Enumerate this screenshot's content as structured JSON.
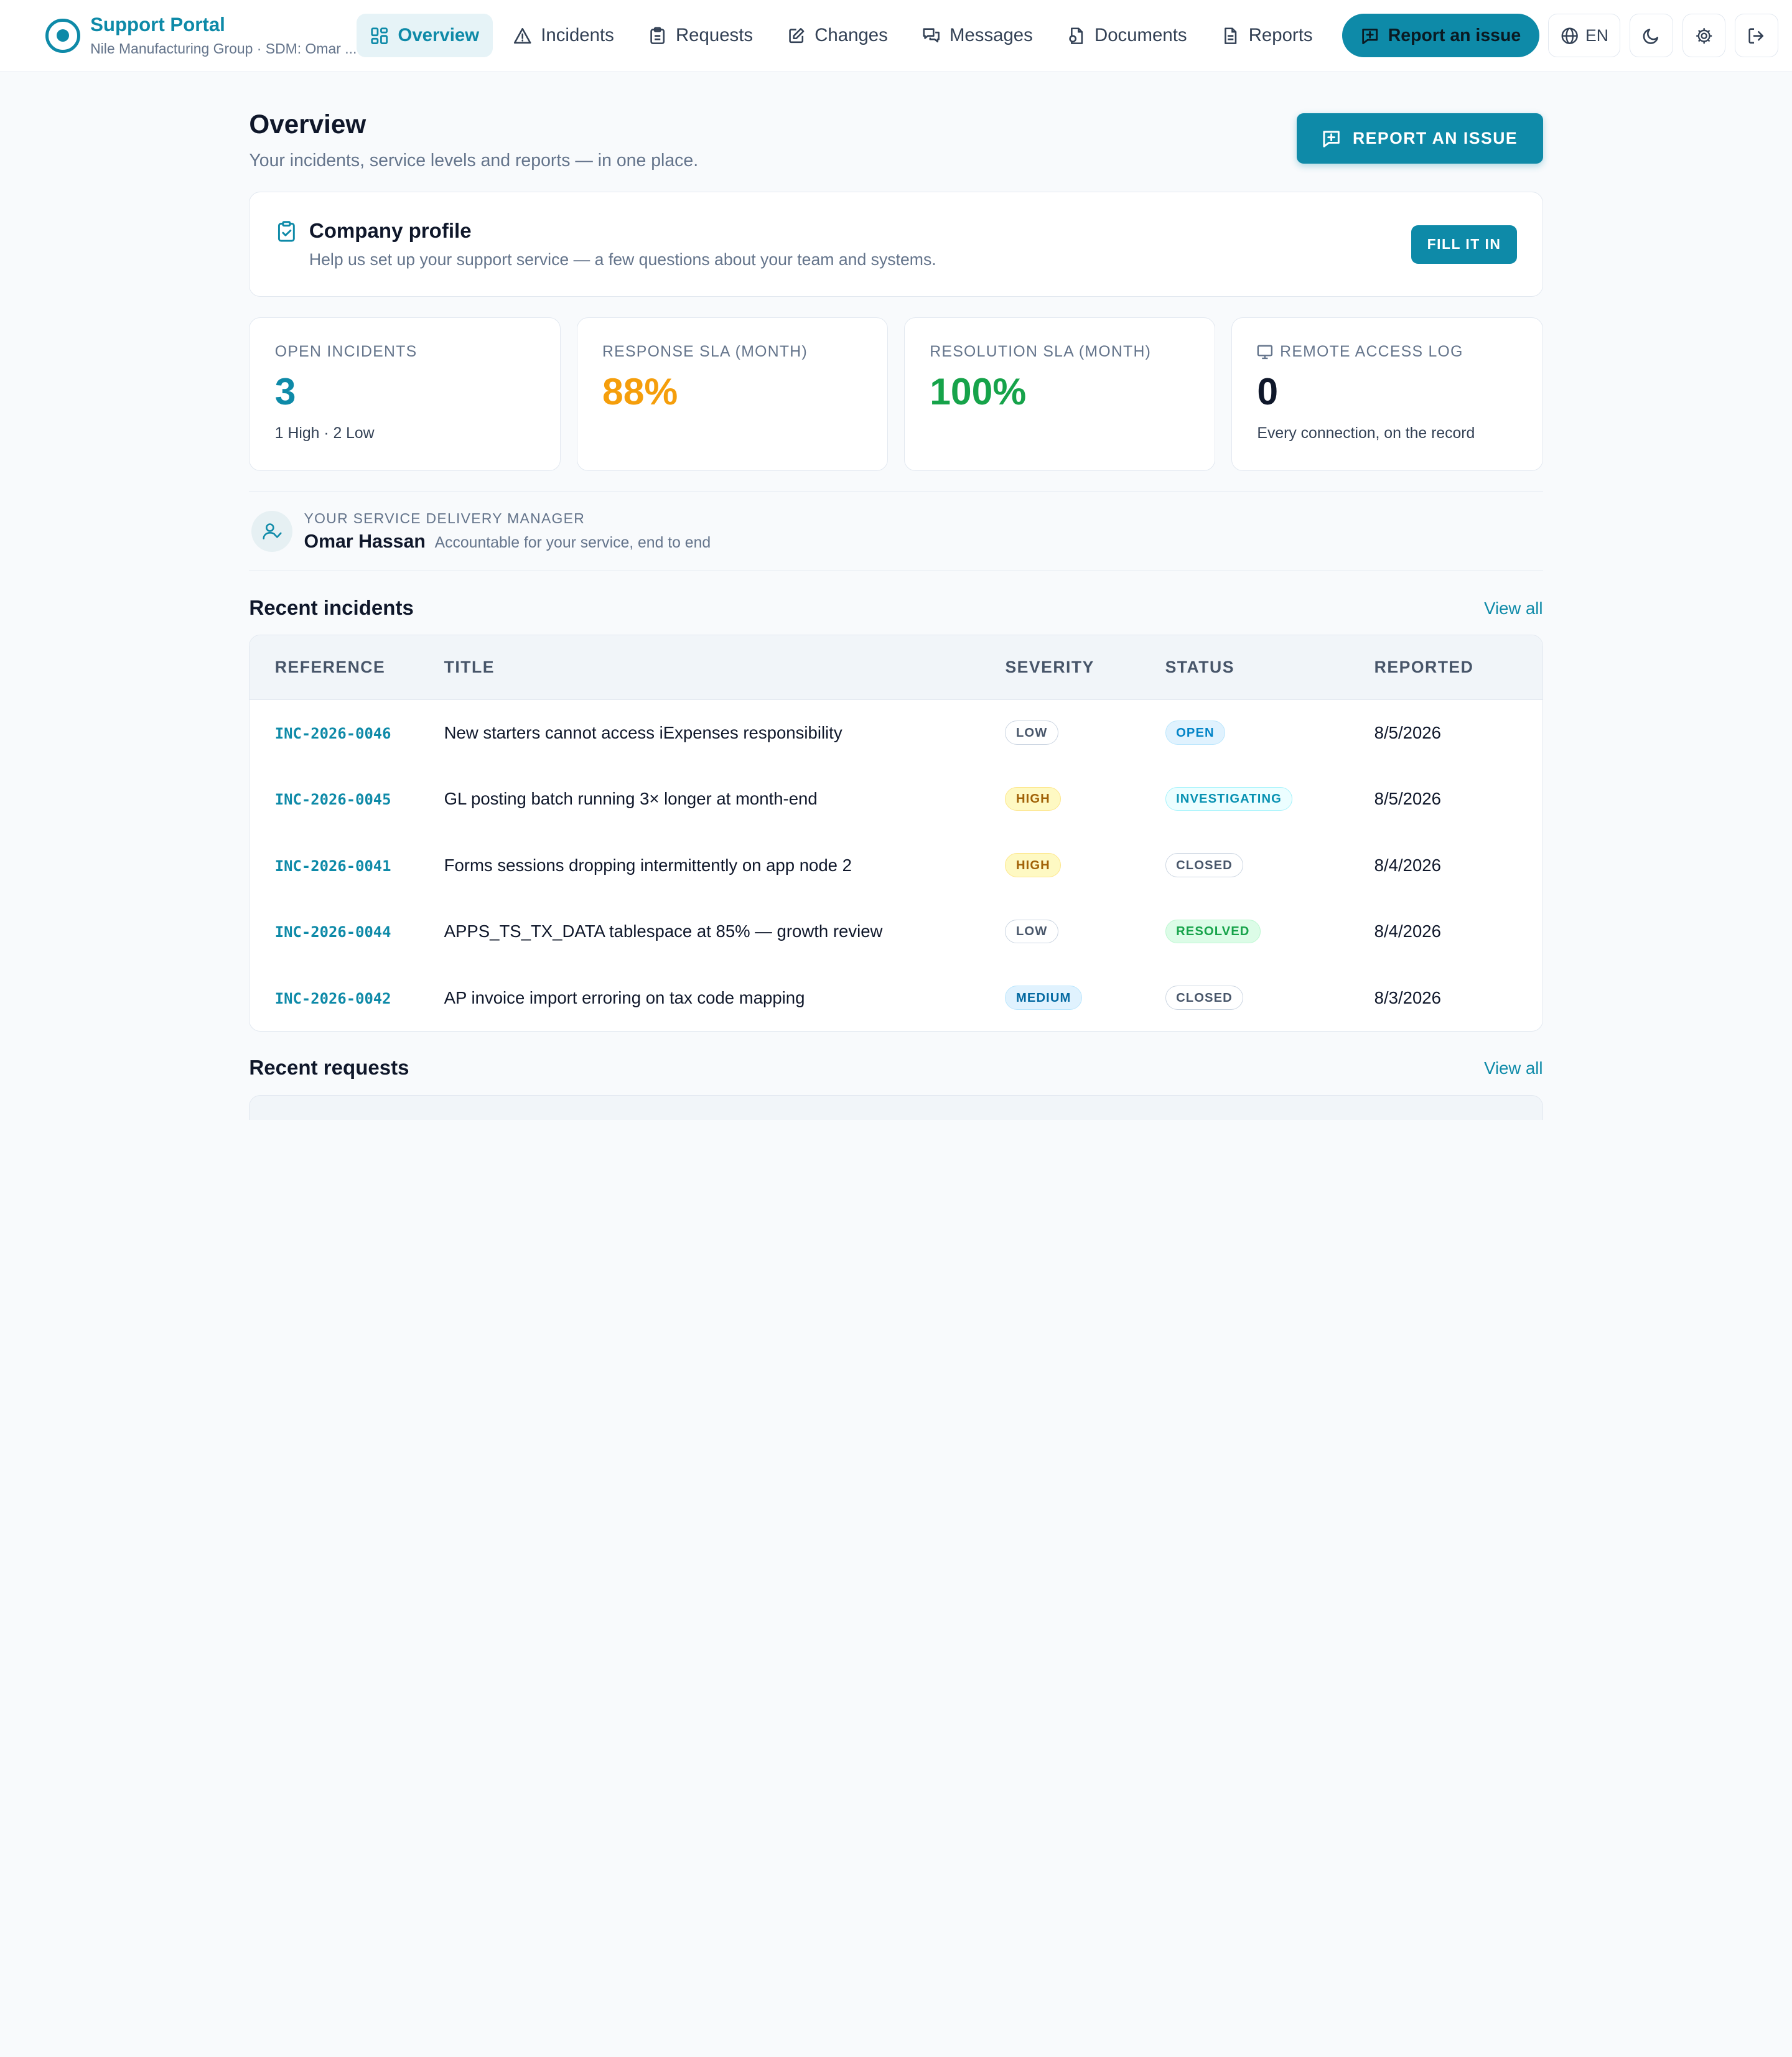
{
  "brand": {
    "title": "Support Portal",
    "subtitle": "Nile Manufacturing Group · SDM: Omar ..."
  },
  "nav": {
    "items": [
      {
        "label": "Overview",
        "icon": "grid-icon",
        "active": true
      },
      {
        "label": "Incidents",
        "icon": "warning-icon"
      },
      {
        "label": "Requests",
        "icon": "clipboard-icon"
      },
      {
        "label": "Changes",
        "icon": "edit-icon"
      },
      {
        "label": "Messages",
        "icon": "messages-icon"
      },
      {
        "label": "Documents",
        "icon": "document-icon"
      },
      {
        "label": "Reports",
        "icon": "report-icon"
      }
    ]
  },
  "top_actions": {
    "report_label": "Report an issue",
    "language": "EN"
  },
  "header": {
    "title": "Overview",
    "subtitle": "Your incidents, service levels and reports — in one place.",
    "report_button": "REPORT AN ISSUE"
  },
  "profile": {
    "title": "Company profile",
    "description": "Help us set up your support service — a few questions about your team and systems.",
    "button": "FILL IT IN"
  },
  "stats": [
    {
      "label": "OPEN INCIDENTS",
      "value": "3",
      "sub": "1 High · 2 Low",
      "color": "#0e8aa8"
    },
    {
      "label": "RESPONSE SLA (MONTH)",
      "value": "88%",
      "sub": "",
      "color": "#f59e0b"
    },
    {
      "label": "RESOLUTION SLA (MONTH)",
      "value": "100%",
      "sub": "",
      "color": "#16a34a"
    },
    {
      "label": "REMOTE ACCESS LOG",
      "value": "0",
      "sub": "Every connection, on the record",
      "color": "#0f172a",
      "icon": "monitor-icon"
    }
  ],
  "sdm": {
    "label": "YOUR SERVICE DELIVERY MANAGER",
    "name": "Omar Hassan",
    "role": "Accountable for your service, end to end"
  },
  "incidents": {
    "title": "Recent incidents",
    "view_all": "View all",
    "columns": [
      "REFERENCE",
      "TITLE",
      "SEVERITY",
      "STATUS",
      "REPORTED"
    ],
    "rows": [
      {
        "ref": "INC-2026-0046",
        "title": "New starters cannot access iExpenses responsibility",
        "severity": "LOW",
        "status": "OPEN",
        "reported": "8/5/2026"
      },
      {
        "ref": "INC-2026-0045",
        "title": "GL posting batch running 3× longer at month-end",
        "severity": "HIGH",
        "status": "INVESTIGATING",
        "reported": "8/5/2026"
      },
      {
        "ref": "INC-2026-0041",
        "title": "Forms sessions dropping intermittently on app node 2",
        "severity": "HIGH",
        "status": "CLOSED",
        "reported": "8/4/2026"
      },
      {
        "ref": "INC-2026-0044",
        "title": "APPS_TS_TX_DATA tablespace at 85% — growth review",
        "severity": "LOW",
        "status": "RESOLVED",
        "reported": "8/4/2026"
      },
      {
        "ref": "INC-2026-0042",
        "title": "AP invoice import erroring on tax code mapping",
        "severity": "MEDIUM",
        "status": "CLOSED",
        "reported": "8/3/2026"
      }
    ]
  },
  "requests": {
    "title": "Recent requests",
    "view_all": "View all"
  },
  "colors": {
    "accent": "#0e8aa8",
    "amber": "#f59e0b",
    "green": "#16a34a"
  }
}
